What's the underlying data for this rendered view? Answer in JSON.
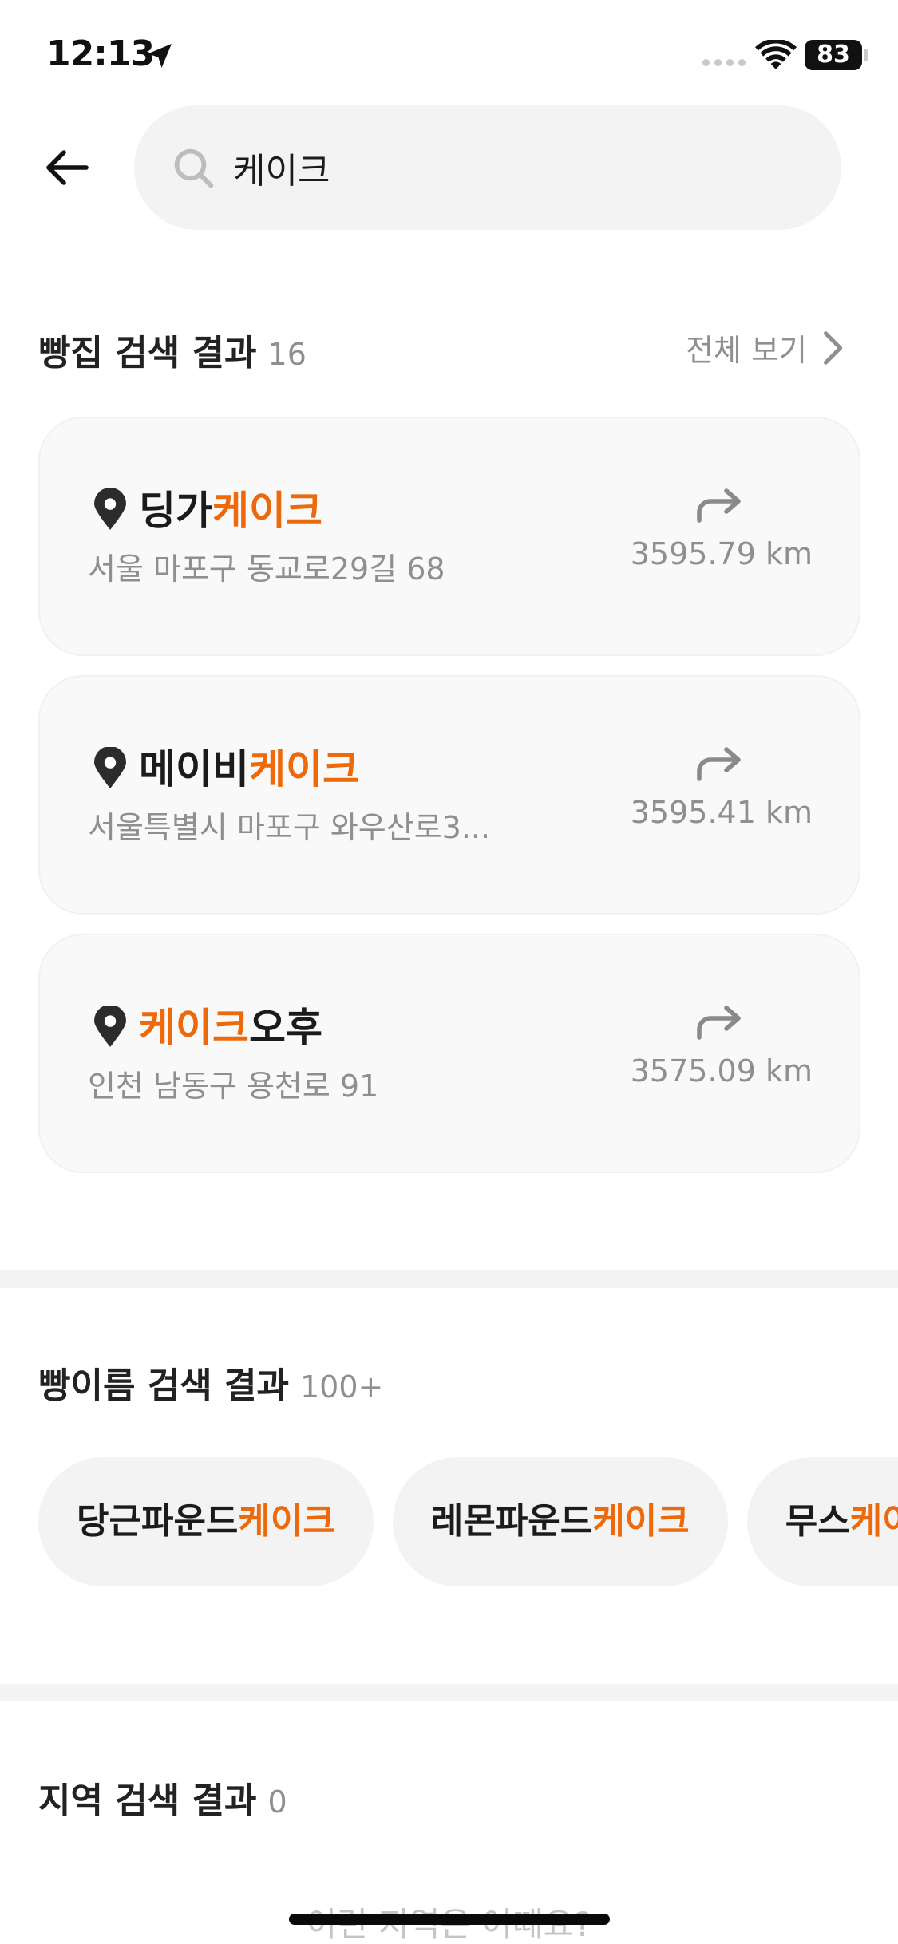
{
  "status_bar": {
    "time": "12:13",
    "battery": "83"
  },
  "search": {
    "query": "케이크",
    "placeholder": ""
  },
  "bakery_section": {
    "title": "빵집 검색 결과",
    "count": "16",
    "see_all": "전체 보기",
    "items": [
      {
        "name_pre": "딩가",
        "name_hl": "케이크",
        "name_post": "",
        "address": "서울 마포구 동교로29길 68",
        "distance": "3595.79 km"
      },
      {
        "name_pre": "메이비",
        "name_hl": "케이크",
        "name_post": "",
        "address": "서울특별시 마포구 와우산로3...",
        "distance": "3595.41 km"
      },
      {
        "name_pre": "",
        "name_hl": "케이크",
        "name_post": "오후",
        "address": "인천 남동구 용천로 91",
        "distance": "3575.09 km"
      }
    ]
  },
  "bread_section": {
    "title": "빵이름 검색 결과",
    "count": "100+",
    "items": [
      {
        "pre": "당근파운드",
        "hl": "케이크"
      },
      {
        "pre": "레몬파운드",
        "hl": "케이크"
      },
      {
        "pre": "무스",
        "hl": "케이크"
      }
    ]
  },
  "region_section": {
    "title": "지역 검색 결과",
    "count": "0",
    "hint": "이런 지역은 어때요?"
  },
  "colors": {
    "accent": "#ec6a0c",
    "muted": "#8f8f8f",
    "card_bg": "#f9f9f9"
  }
}
